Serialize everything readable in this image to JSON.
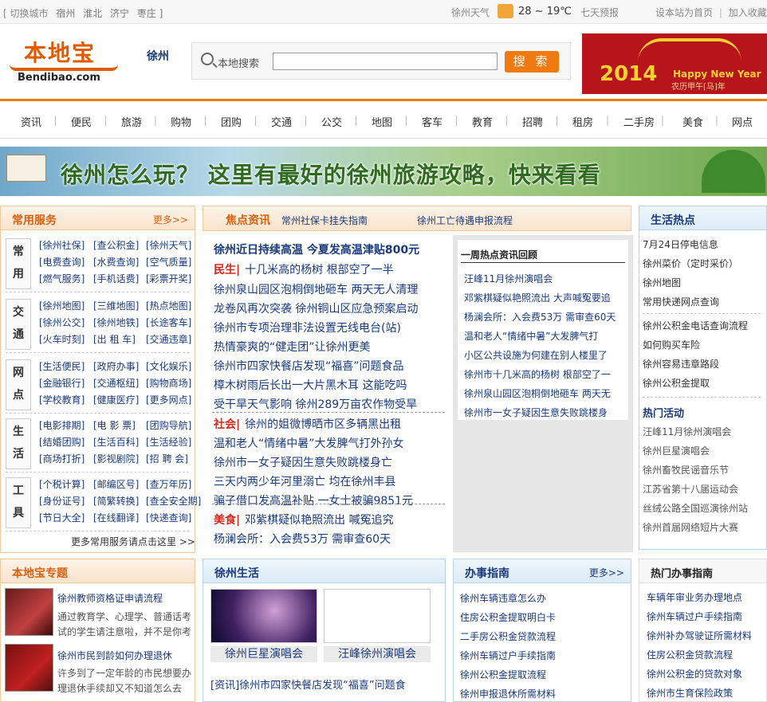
{
  "topbar": {
    "switch_city": "[ 切换城市",
    "nearby": [
      "宿州",
      "淮北",
      "济宁",
      "枣庄 ]"
    ],
    "weather_label": "徐州天气",
    "temp": "28 ~ 19℃",
    "seven_day": "七天预报",
    "set_home": "设本站为首页",
    "divider": "|",
    "bookmark": "加入收藏"
  },
  "logo": {
    "cn": "本地宝",
    "en": "Bendibao.com"
  },
  "city": "徐州",
  "search": {
    "label": "本地搜索",
    "button": "搜 索",
    "value": ""
  },
  "ad": {
    "year": "2014",
    "text": "Happy New Year",
    "sub": "农历甲午[马]年"
  },
  "nav": [
    "资讯",
    "便民",
    "旅游",
    "购物",
    "团购",
    "交通",
    "公交",
    "地图",
    "客车",
    "教育",
    "招聘",
    "租房",
    "二手房",
    "美食",
    "网点"
  ],
  "banner": {
    "text": "徐州怎么玩？  这里有最好的徐州旅游攻略，快来看看"
  },
  "services": {
    "title": "常用服务",
    "more": "更多>>",
    "groups": [
      {
        "cat": [
          "常",
          "用"
        ],
        "links": [
          "[徐州社保]",
          "[查公积金]",
          "[徐州天气]",
          "[电费查询]",
          "[水费查询]",
          "[空气质量]",
          "[燃气服务]",
          "[手机话费]",
          "[彩票开奖]"
        ]
      },
      {
        "cat": [
          "交",
          "通"
        ],
        "links": [
          "[徐州地图]",
          "[三维地图]",
          "[热点地图]",
          "[徐州公交]",
          "[徐州地铁]",
          "[长途客车]",
          "[火车时刻]",
          "[出 租 车]",
          "[交通违章]"
        ]
      },
      {
        "cat": [
          "网",
          "点"
        ],
        "links": [
          "[生活便民]",
          "[政府办事]",
          "[文化娱乐]",
          "[金融银行]",
          "[交通枢纽]",
          "[购物商场]",
          "[学校教育]",
          "[健康医疗]",
          "[更多网点]"
        ]
      },
      {
        "cat": [
          "生",
          "活"
        ],
        "links": [
          "[电影排期]",
          "[电 影 票]",
          "[团购导航]",
          "[结婚团购]",
          "[生活百科]",
          "[生活经验]",
          "[商场打折]",
          "[影视剧院]",
          "[招 聘 会]"
        ]
      },
      {
        "cat": [
          "工",
          "具"
        ],
        "links": [
          "[个税计算]",
          "[邮编区号]",
          "[查万年历]",
          "[身份证号]",
          "[简繁转换]",
          "[查全安全期]",
          "[节日大全]",
          "[在线翻译]",
          "[快递查询]"
        ]
      }
    ],
    "bottom_more": "更多常用服务请点击这里 >>"
  },
  "focus": {
    "title": "焦点资讯",
    "links": [
      "常州社保卡挂失指南",
      "徐州工亡待遇申报流程"
    ],
    "headline": "徐州近日持续高温 今夏发高温津贴800元",
    "items": [
      {
        "tag": "民生|",
        "text": "十几米高的杨树 根部空了一半"
      },
      {
        "tag": "",
        "text": "徐州泉山园区泡桐倒地砸车 两天无人清理"
      },
      {
        "tag": "",
        "text": "龙卷风再次突袭 徐州铜山区应急预案启动"
      },
      {
        "tag": "",
        "text": "徐州市专项治理非法设置无线电台(站)"
      },
      {
        "tag": "",
        "text": "热情豪爽的“健走团”让徐州更美"
      },
      {
        "tag": "",
        "text": "徐州市四家快餐店发现“福喜”问题食品"
      },
      {
        "tag": "",
        "text": "樟木树雨后长出一大片黑木耳 这能吃吗"
      },
      {
        "tag": "",
        "text": "受干旱天气影响 徐州289万亩农作物受旱"
      },
      {
        "tag": "社会|",
        "text": "徐州的姐微博晒市区多辆黑出租"
      },
      {
        "tag": "",
        "text": "温和老人“情绪中暑”大发脾气打外孙女"
      },
      {
        "tag": "",
        "text": "徐州市一女子疑因生意失败跳楼身亡"
      },
      {
        "tag": "",
        "text": "三天内两少年河里溺亡 均在徐州丰县"
      },
      {
        "tag": "",
        "text": "骗子借口发高温补贴 一女士被骗9851元"
      },
      {
        "tag": "美食|",
        "text": "邓紫棋疑似艳照流出 喊冤追究"
      },
      {
        "tag": "",
        "text": "杨澜会所：入会费53万 需审查60天"
      }
    ]
  },
  "weekly": {
    "title": "一周热点资讯回顾",
    "items": [
      "汪峰11月徐州演唱会",
      "邓紫棋疑似艳照流出 大声喊冤要追",
      "杨澜会所：入会费53万 需审查60天",
      "温和老人“情绪中暑”大发脾气打",
      "小区公共设施为何建在别人楼里了",
      "徐州市十几米高的杨树 根部空了一",
      "徐州泉山园区泡桐倒地砸车 两天无",
      "徐州市一女子疑因生意失败跳楼身"
    ]
  },
  "hot": {
    "title": "生活热点",
    "items": [
      "7月24日停电信息",
      "徐州菜价（定时采价）",
      "徐州地图",
      "常用快递网点查询",
      "徐州公积金电话查询流程",
      "如何购买车险",
      "徐州容易违章路段",
      "徐州公积金提取"
    ],
    "activity_title": "热门活动",
    "activities": [
      "汪峰11月徐州演唱会",
      "徐州巨星演唱会",
      "徐州畜牧民谣音乐节",
      "江苏省第十八届运动会",
      "丝绒公路全国巡演徐州站",
      "徐州首届网络短片大赛"
    ]
  },
  "topics": {
    "title": "本地宝专题",
    "items": [
      {
        "title": "徐州教师资格证申请流程",
        "desc": [
          "通过教育学、心理学、普通话考",
          "试的学生请注意啦，并不是你考"
        ]
      },
      {
        "title": "徐州市民到龄如何办理退休",
        "desc": [
          "许多到了一定年龄的市民想要办",
          "理退休手续却又不知道怎么去"
        ]
      }
    ]
  },
  "life": {
    "title": "徐州生活",
    "photos": [
      "徐州巨星演唱会",
      "汪峰徐州演唱会"
    ],
    "news": "[资讯]徐州市四家快餐店发现“福喜”问题食"
  },
  "guide": {
    "title": "办事指南",
    "more": "更多>>",
    "items": [
      "徐州车辆违章怎么办",
      "住房公积金提取明白卡",
      "二手房公积金贷款流程",
      "徐州车辆过户手续指南",
      "徐州公积金提取流程",
      "徐州申报退休所需材料"
    ]
  },
  "hotguide": {
    "title": "热门办事指南",
    "items": [
      "车辆年审业务办理地点",
      "徐州车辆过户手续指南",
      "徐州补办驾驶证所需材料",
      "住房公积金贷款流程",
      "徐州公积金的贷款对象",
      "徐州市生育保险政策"
    ]
  },
  "colors": {
    "accent": "#f07a10",
    "link": "#1a3a7a",
    "tag_red": "#d8261a"
  }
}
